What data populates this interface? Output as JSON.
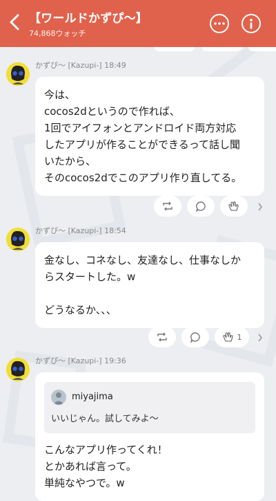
{
  "header": {
    "title": "【ワールドかずぴ〜】",
    "subtitle": "74,868ウォッチ",
    "icons": [
      "back-arrow-icon",
      "more-options-icon",
      "info-icon"
    ]
  },
  "messages": [
    {
      "author": "かずぴ〜 [Kazupi-]",
      "time": "18:49",
      "lines": [
        "今は、",
        "cocos2dというので作れば、",
        "1回でアイフォンとアンドロイド両方対応",
        "したアプリが作ることができるって話し聞",
        "いたから、",
        "そのcocos2dでこのアプリ作り直してる。"
      ],
      "reactions": {
        "reshare": "",
        "comment": "",
        "clap": ""
      }
    },
    {
      "author": "かずぴ〜 [Kazupi-]",
      "time": "18:54",
      "lines": [
        "金なし、コネなし、友達なし、仕事なしか",
        "らスタートした。w",
        "",
        "どうなるか、、、"
      ],
      "reactions": {
        "reshare": "",
        "comment": "",
        "clap": "1"
      }
    },
    {
      "author": "かずぴ〜 [Kazupi-]",
      "time": "19:36",
      "quote": {
        "user": "miyajima",
        "text": "いいじゃん。試してみよ〜"
      },
      "lines": [
        "こんなアプリ作ってくれ！",
        "とかあれば言って。",
        "単純なやつで。w"
      ]
    }
  ],
  "colors": {
    "header": "#e0624c",
    "background": "#eceef1",
    "avatar": "#f2dd35"
  }
}
